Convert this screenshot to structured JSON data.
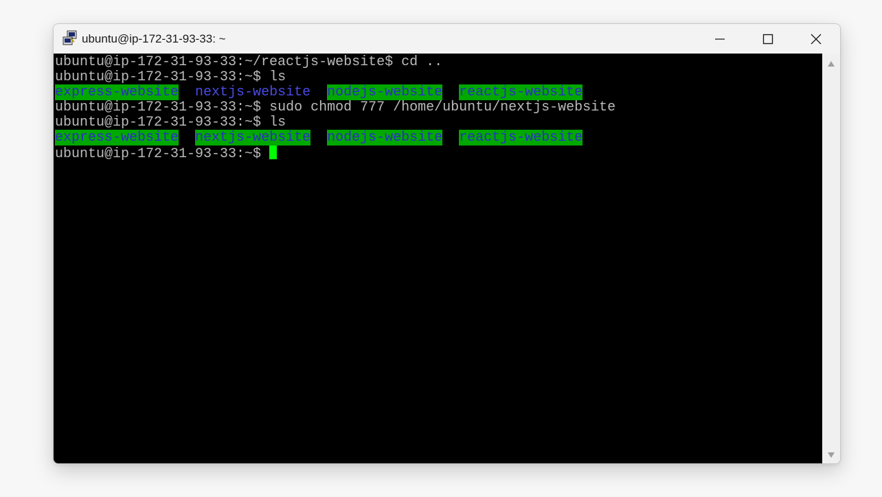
{
  "window": {
    "title": "ubuntu@ip-172-31-93-33: ~",
    "controls": {
      "minimize_icon": "minimize-icon",
      "maximize_icon": "maximize-icon",
      "close_icon": "close-icon"
    }
  },
  "terminal": {
    "colors": {
      "background": "#000000",
      "foreground": "#bbbbbb",
      "dir_highlight_bg": "#00a800",
      "dir_highlight_fg": "#2d2dc8",
      "dir_fg": "#4a4ae6",
      "cursor": "#00ff00"
    },
    "lines": [
      {
        "prompt": "ubuntu@ip-172-31-93-33:~/reactjs-website$",
        "command": " cd .."
      },
      {
        "prompt": "ubuntu@ip-172-31-93-33:~$",
        "command": " ls"
      },
      {
        "dirs": [
          "express-website",
          "nextjs-website",
          "nodejs-website",
          "reactjs-website"
        ]
      },
      {
        "prompt": "ubuntu@ip-172-31-93-33:~$",
        "command": " sudo chmod 777 /home/ubuntu/nextjs-website"
      },
      {
        "prompt": "ubuntu@ip-172-31-93-33:~$",
        "command": " ls"
      },
      {
        "dirs": [
          "express-website",
          "nextjs-website",
          "nodejs-website",
          "reactjs-website"
        ]
      },
      {
        "prompt": "ubuntu@ip-172-31-93-33:~$",
        "command": " "
      }
    ],
    "sep": "  "
  }
}
